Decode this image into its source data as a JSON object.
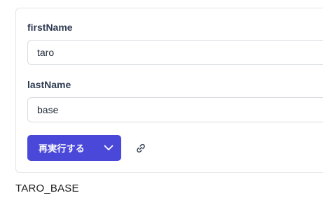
{
  "form": {
    "first_name": {
      "label": "firstName",
      "value": "taro"
    },
    "last_name": {
      "label": "lastName",
      "value": "base"
    },
    "run_button": {
      "label": "再実行する",
      "dropdown_icon": "chevron-down-icon"
    },
    "link_icon": "link-icon"
  },
  "result": {
    "text": "TARO_BASE"
  },
  "colors": {
    "accent": "#4a48d9",
    "label": "#2f3b52",
    "border": "#d7dbe0"
  }
}
